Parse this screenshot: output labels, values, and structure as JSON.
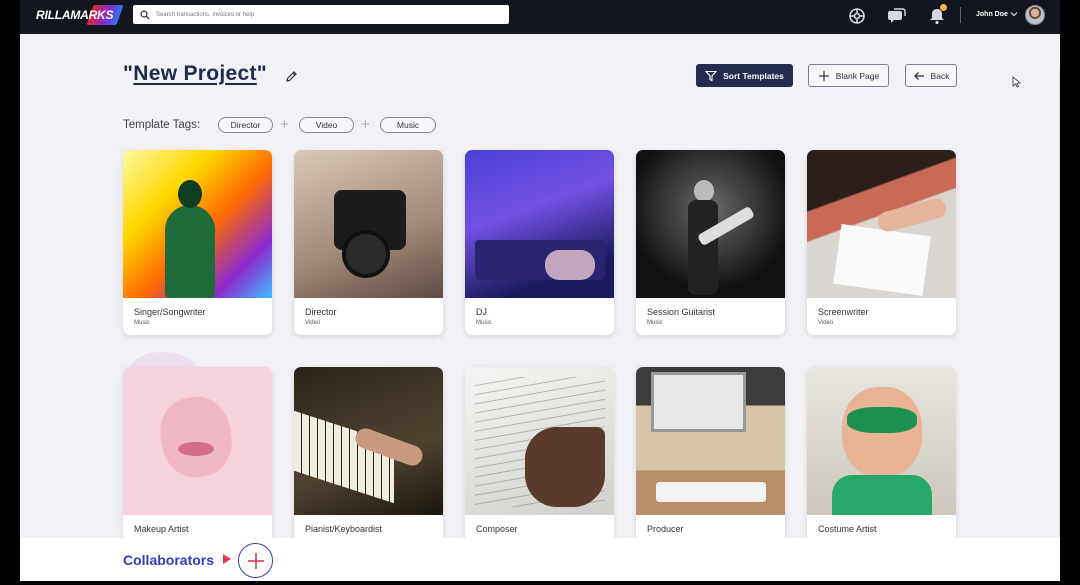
{
  "header": {
    "logo_text": "RILLAMARKS",
    "search_placeholder": "Search transactions, invoices or help",
    "username": "John Doe"
  },
  "project": {
    "title_open_quote": "\"",
    "title_name": "New Project",
    "title_close_quote": "\""
  },
  "toolbar": {
    "sort_label": "Sort Templates",
    "blank_label": "Blank Page",
    "back_label": "Back"
  },
  "tags": {
    "label": "Template Tags:",
    "items": [
      "Director",
      "Video",
      "Music"
    ]
  },
  "templates": [
    {
      "title": "Singer/Songwriter",
      "tag": "Music"
    },
    {
      "title": "Director",
      "tag": "Video"
    },
    {
      "title": "DJ",
      "tag": "Music"
    },
    {
      "title": "Session Guitarist",
      "tag": "Music"
    },
    {
      "title": "Screenwriter",
      "tag": "Video"
    },
    {
      "title": "Makeup Artist",
      "tag": ""
    },
    {
      "title": "Pianist/Keyboardist",
      "tag": ""
    },
    {
      "title": "Composer",
      "tag": ""
    },
    {
      "title": "Producer",
      "tag": ""
    },
    {
      "title": "Costume Artist",
      "tag": ""
    }
  ],
  "footer": {
    "collaborators_label": "Collaborators"
  },
  "colors": {
    "accent": "#3b38b8",
    "primary_button": "#262b52",
    "topbar": "#14161f",
    "background": "#f1f1f6"
  },
  "icons": [
    "search-icon",
    "globe-icon",
    "chat-icon",
    "bell-icon",
    "chevron-down-icon",
    "pencil-icon",
    "filter-icon",
    "plus-icon",
    "arrow-left-icon",
    "play-arrow-icon"
  ]
}
